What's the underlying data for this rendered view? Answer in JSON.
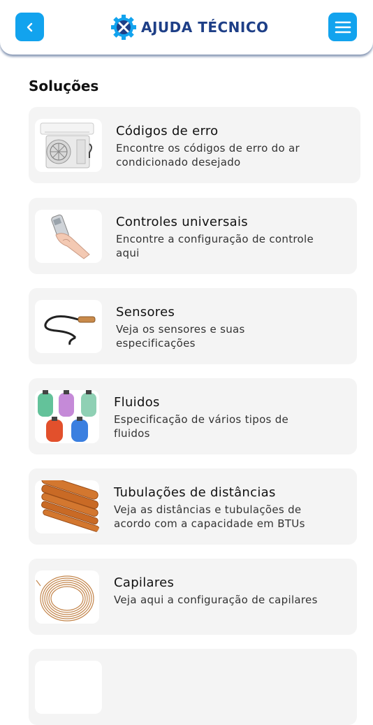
{
  "header": {
    "back_icon": "chevron-left-icon",
    "logo_icon": "gear-tools-icon",
    "title": "AJUDA TÉCNICO",
    "menu_icon": "hamburger-menu-icon",
    "accent_color": "#12a3ee",
    "brand_color": "#1e3f87"
  },
  "section": {
    "title": "Soluções"
  },
  "solutions": [
    {
      "title": "Códigos de erro",
      "description": "Encontre os códigos de erro do ar condicionado desejado",
      "image": "air-conditioner-image"
    },
    {
      "title": "Controles universais",
      "description": "Encontre a configuração de controle aqui",
      "image": "remote-control-hand-image"
    },
    {
      "title": "Sensores",
      "description": "Veja os sensores e suas especificações",
      "image": "sensor-cable-image"
    },
    {
      "title": "Fluidos",
      "description": "Especificação de vários tipos de fluidos",
      "image": "refrigerant-cylinders-image"
    },
    {
      "title": "Tubulações de distâncias",
      "description": "Veja as distâncias e tubulações de acordo com a capacidade em BTUs",
      "image": "copper-pipes-image"
    },
    {
      "title": "Capilares",
      "description": "Veja aqui a configuração de capilares",
      "image": "capillary-coil-image"
    }
  ]
}
